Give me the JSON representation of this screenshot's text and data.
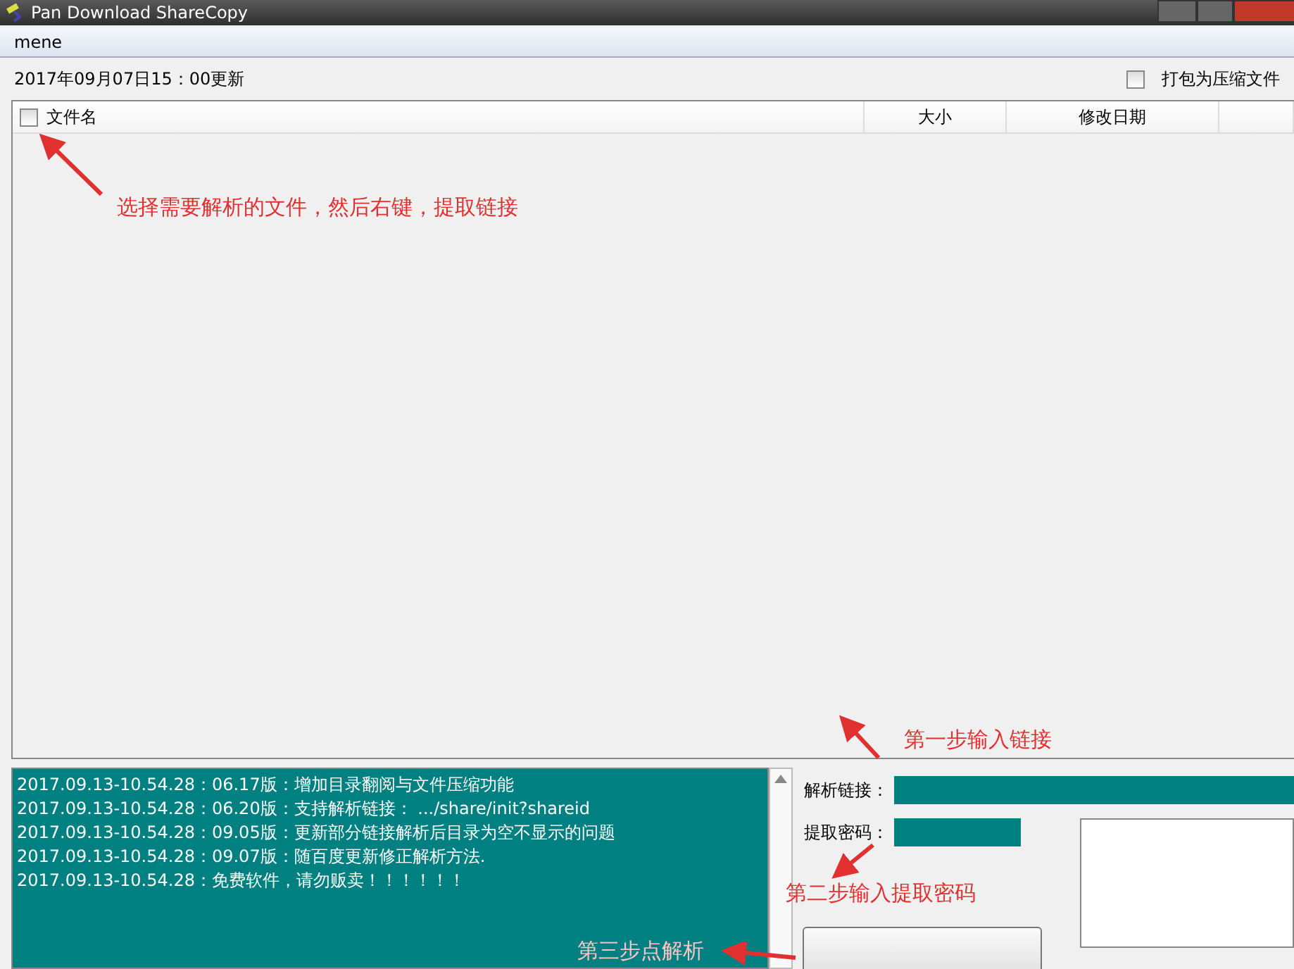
{
  "window": {
    "title": "Pan Download ShareCopy"
  },
  "menu": [
    "mene"
  ],
  "update_text": "2017年09月07日15：00更新",
  "compress_option": {
    "label": "打包为压缩文件",
    "checked": false
  },
  "table": {
    "select_all_checked": false,
    "columns": [
      {
        "label": "文件名"
      },
      {
        "label": "大小"
      },
      {
        "label": "修改日期"
      }
    ]
  },
  "log": [
    "2017.09.13-10.54.28：06.17版：增加目录翻阅与文件压缩功能",
    "2017.09.13-10.54.28：06.20版：支持解析链接： .../share/init?shareid",
    "2017.09.13-10.54.28：09.05版：更新部分链接解析后目录为空不显示的问题",
    "2017.09.13-10.54.28：09.07版：随百度更新修正解析方法.",
    "2017.09.13-10.54.28：免费软件，请勿贩卖！！！！！！"
  ],
  "link_field": {
    "label": "解析链接："
  },
  "password_field": {
    "label": "提取密码："
  },
  "annotations": [
    {
      "kind": "files",
      "text": "选择需要解析的文件，然后右键，提取链接"
    },
    {
      "kind": "link",
      "text": "第一步输入链接"
    },
    {
      "kind": "password",
      "text": "第二步输入提取密码"
    },
    {
      "kind": "parse",
      "text": "第三步点解析"
    }
  ]
}
